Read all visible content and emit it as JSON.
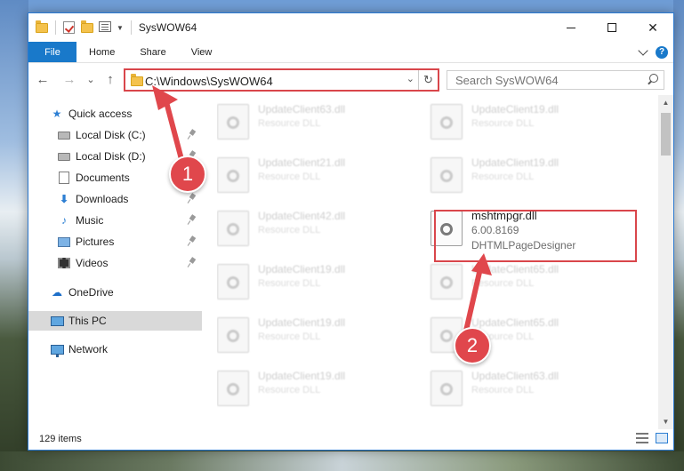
{
  "window": {
    "title": "SysWOW64",
    "controls": {
      "minimize": "",
      "maximize": "",
      "close": "✕"
    }
  },
  "ribbon": {
    "file_tab": "File",
    "tabs": [
      "Home",
      "Share",
      "View"
    ]
  },
  "nav": {
    "back": "←",
    "forward": "→",
    "recent": "⌄",
    "up": "↑",
    "address": "C:\\Windows\\SysWOW64",
    "refresh": "↻",
    "search_placeholder": "Search SysWOW64"
  },
  "sidebar": {
    "items": [
      {
        "label": "Quick access"
      },
      {
        "label": "Local Disk (C:)"
      },
      {
        "label": "Local Disk (D:)"
      },
      {
        "label": "Documents"
      },
      {
        "label": "Downloads"
      },
      {
        "label": "Music"
      },
      {
        "label": "Pictures"
      },
      {
        "label": "Videos"
      },
      {
        "label": "OneDrive"
      },
      {
        "label": "This PC"
      },
      {
        "label": "Network"
      }
    ]
  },
  "files": {
    "col1": [
      {
        "name": "UpdateClient63.dll",
        "sub": "Resource DLL"
      },
      {
        "name": "UpdateClient21.dll",
        "sub": "Resource DLL"
      },
      {
        "name": "UpdateClient42.dll",
        "sub": "Resource DLL"
      },
      {
        "name": "UpdateClient19.dll",
        "sub": "Resource DLL"
      },
      {
        "name": "UpdateClient19.dll",
        "sub": "Resource DLL"
      },
      {
        "name": "UpdateClient19.dll",
        "sub": "Resource DLL"
      }
    ],
    "col2": [
      {
        "name": "UpdateClient19.dll",
        "sub": "Resource DLL"
      },
      {
        "name": "UpdateClient19.dll",
        "sub": "Resource DLL"
      },
      {
        "name": "UpdateClient65.dll",
        "sub": "Resource DLL"
      },
      {
        "name": "UpdateClient65.dll",
        "sub": "Resource DLL"
      },
      {
        "name": "UpdateClient63.dll",
        "sub": "Resource DLL"
      }
    ],
    "highlighted": {
      "name": "mshtmpgr.dll",
      "version": "6.00.8169",
      "description": "DHTMLPageDesigner"
    }
  },
  "status": {
    "item_count": "129 items"
  },
  "annotations": {
    "callout1": "1",
    "callout2": "2",
    "color": "#e0474c"
  }
}
